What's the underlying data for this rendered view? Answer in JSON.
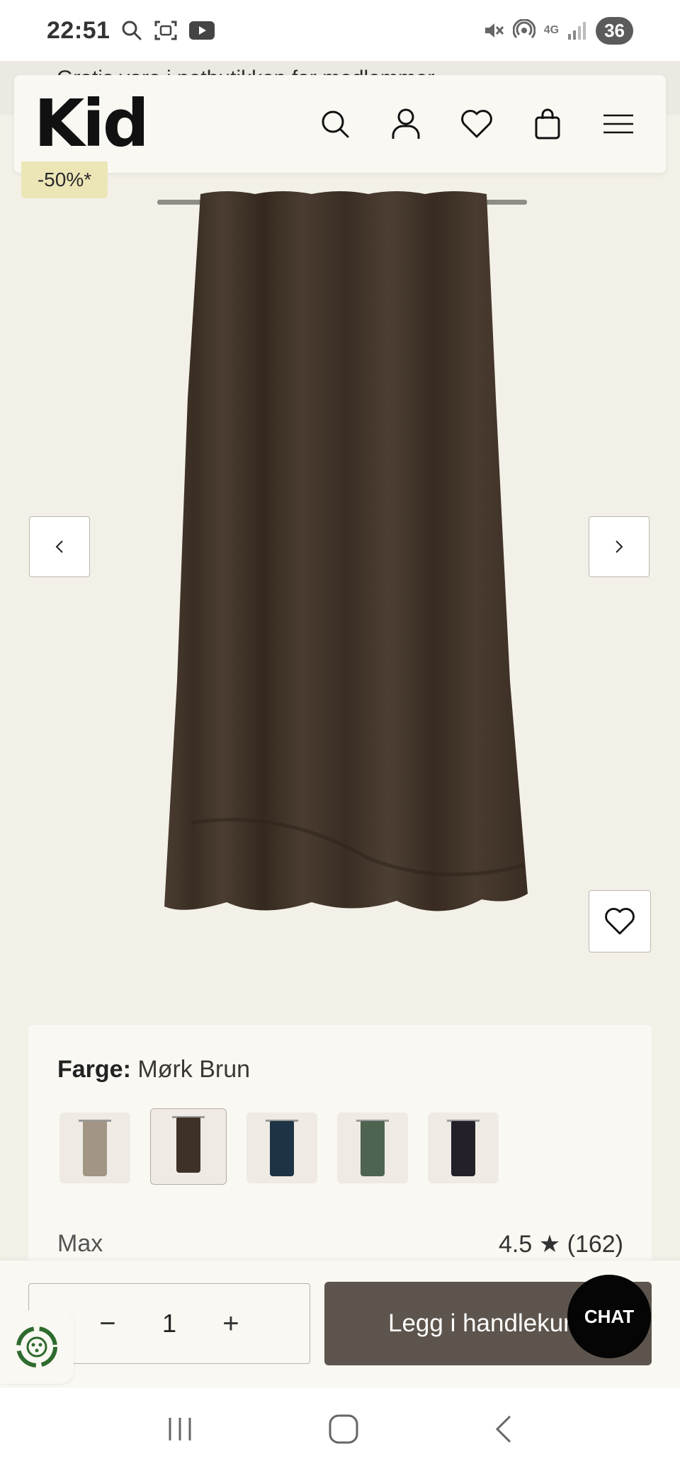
{
  "status_bar": {
    "time": "22:51",
    "network": "4G",
    "battery": "36",
    "icons": [
      "search-icon",
      "screenshot-icon",
      "youtube-icon",
      "mute-icon",
      "hotspot-icon",
      "signal-icon"
    ]
  },
  "promo_strip": {
    "text": "Gratis vare i netbutikken for medlemmer"
  },
  "header": {
    "logo": "Kid",
    "icons": [
      "search-icon",
      "account-icon",
      "wishlist-heart-icon",
      "shopping-bag-icon",
      "menu-icon"
    ]
  },
  "product": {
    "discount_badge": "-50%*",
    "image_alt": "Mørk brun fløyelsgardin",
    "colors": {
      "curtain": "#3e3228",
      "background": "#f3f0e8"
    }
  },
  "carousel": {
    "prev_label": "‹",
    "next_label": "›"
  },
  "options": {
    "color_label": "Farge:",
    "color_value": "Mørk Brun",
    "swatches": [
      {
        "name": "Beige",
        "color": "#a29585",
        "selected": false
      },
      {
        "name": "Mørk Brun",
        "color": "#3e3228",
        "selected": true
      },
      {
        "name": "Blå",
        "color": "#1e3345",
        "selected": false
      },
      {
        "name": "Grønn",
        "color": "#4e6450",
        "selected": false
      },
      {
        "name": "Sort",
        "color": "#23202a",
        "selected": false
      }
    ],
    "product_name": "Max",
    "rating_value": "4.5",
    "rating_star": "★",
    "rating_count": "(162)"
  },
  "purchase": {
    "qty_minus": "−",
    "qty_value": "1",
    "qty_plus": "+",
    "add_to_cart": "Legg i handlekurv"
  },
  "chat": {
    "label": "CHAT"
  }
}
